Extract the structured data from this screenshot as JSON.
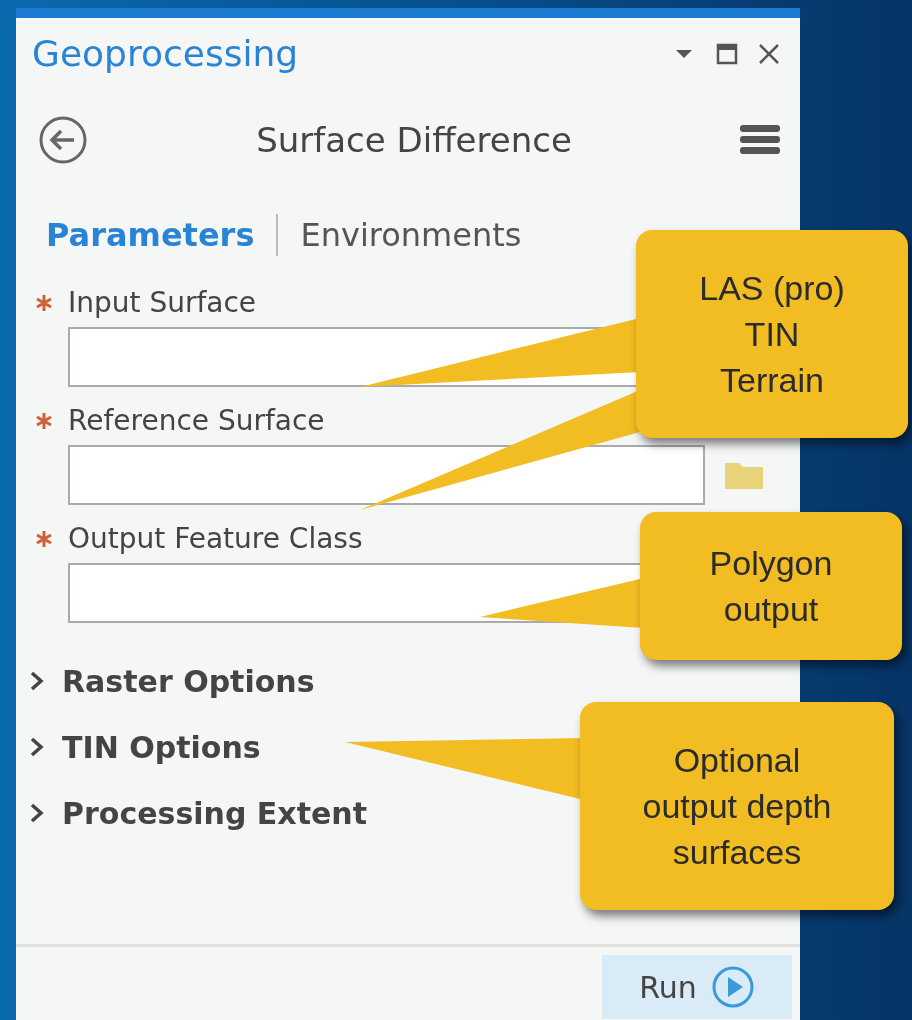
{
  "pane": {
    "title": "Geoprocessing"
  },
  "tool": {
    "title": "Surface Difference"
  },
  "tabs": [
    {
      "label": "Parameters",
      "selected": true
    },
    {
      "label": "Environments",
      "selected": false
    }
  ],
  "parameters": [
    {
      "label": "Input Surface",
      "required": true,
      "browse": false
    },
    {
      "label": "Reference Surface",
      "required": true,
      "browse": true
    },
    {
      "label": "Output Feature Class",
      "required": true,
      "browse": false
    }
  ],
  "sections": [
    {
      "label": "Raster Options",
      "expanded": false
    },
    {
      "label": "TIN Options",
      "expanded": false
    },
    {
      "label": "Processing Extent",
      "expanded": false
    }
  ],
  "run_button": {
    "label": "Run"
  },
  "callouts": [
    {
      "lines": [
        "LAS (pro)",
        "TIN",
        "Terrain"
      ]
    },
    {
      "lines": [
        "Polygon",
        "output"
      ]
    },
    {
      "lines": [
        "Optional",
        "output depth",
        "surfaces"
      ]
    }
  ]
}
